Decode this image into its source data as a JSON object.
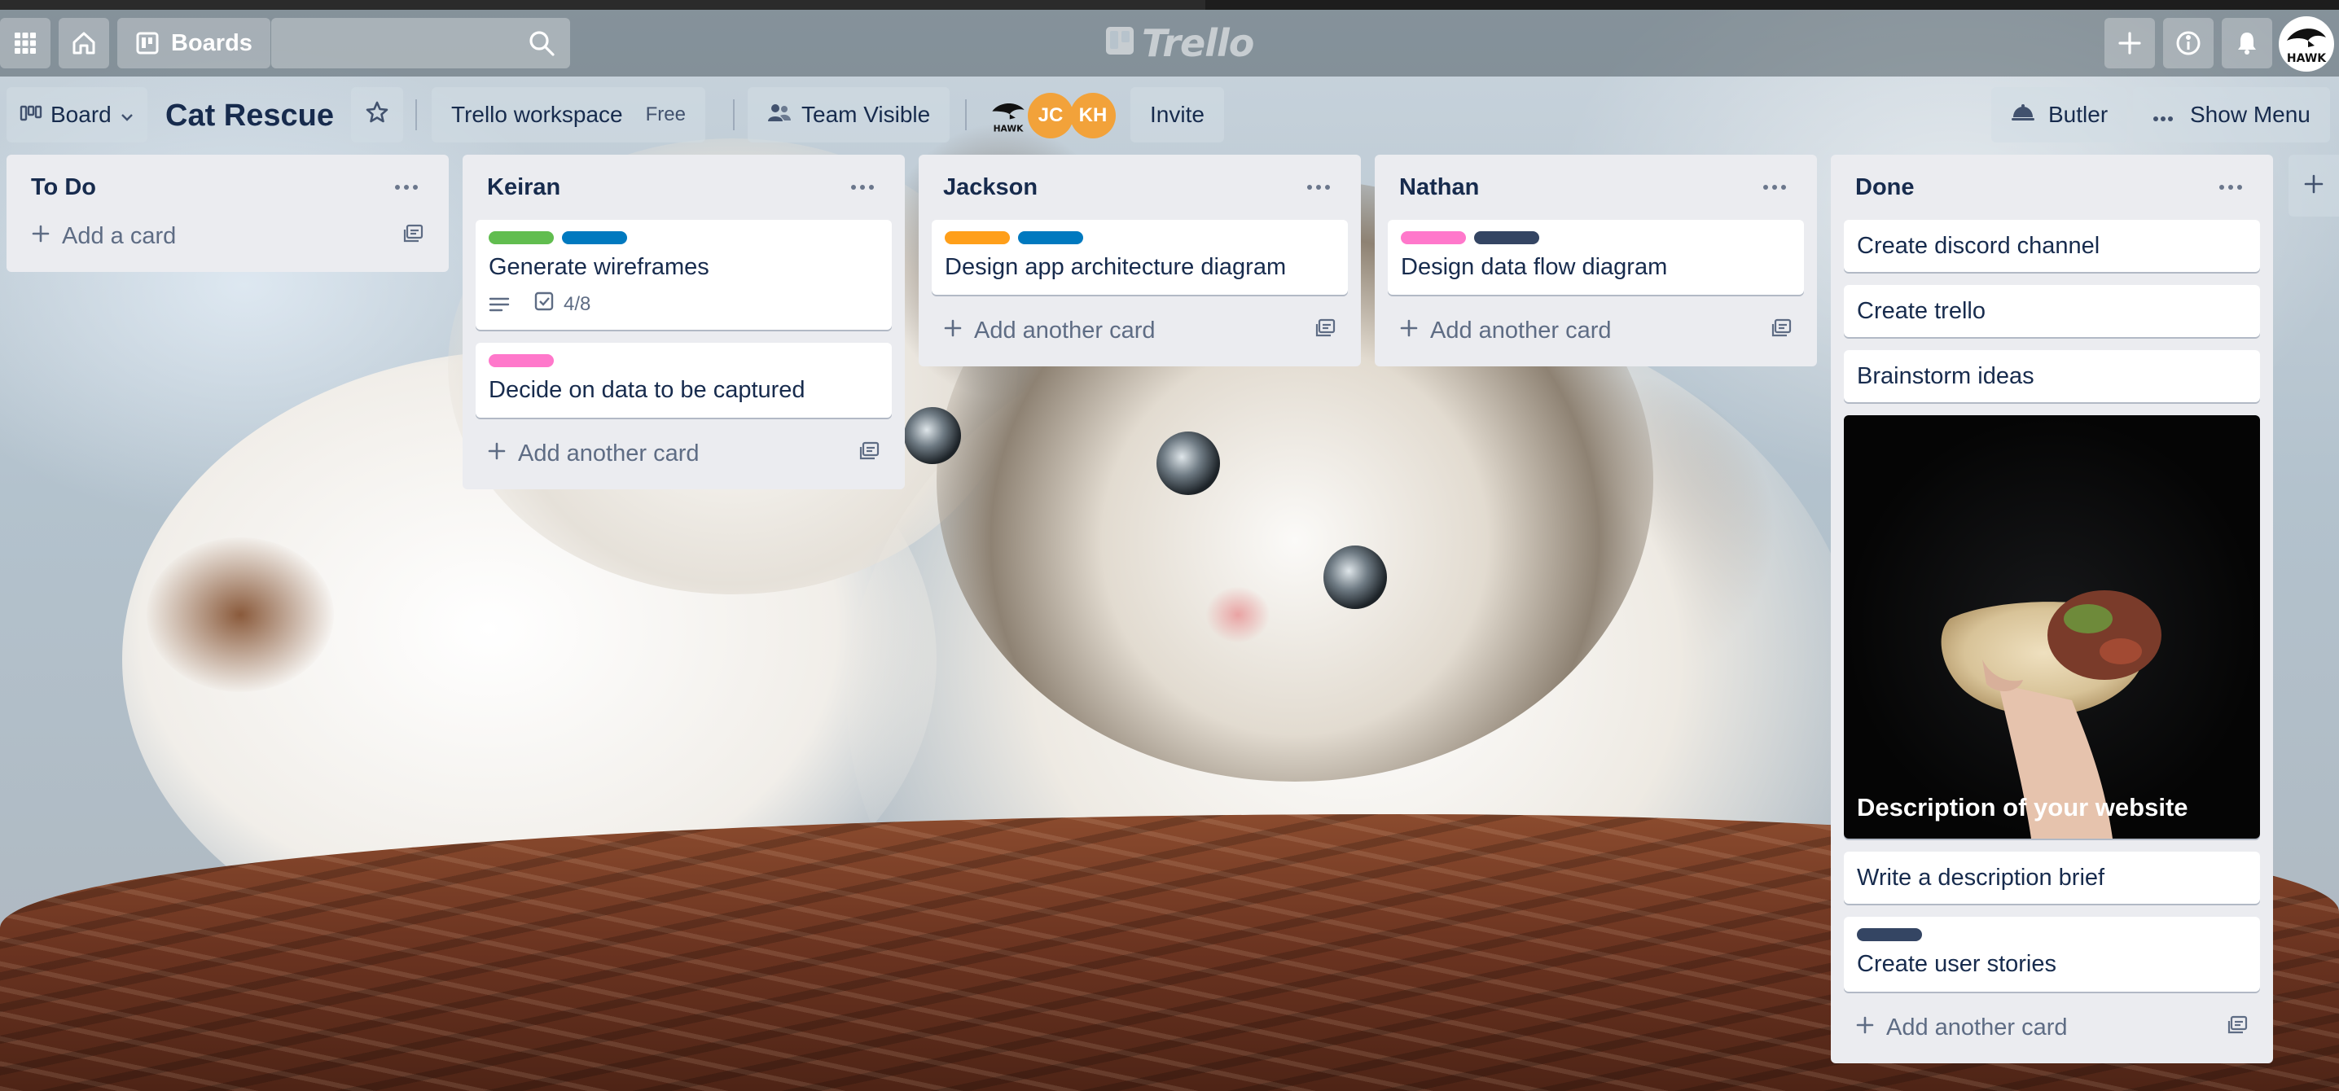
{
  "topbar": {
    "boards_label": "Boards",
    "logo_text": "Trello",
    "icons": [
      "apps-icon",
      "home-icon",
      "boards-icon",
      "search-icon",
      "plus-icon",
      "info-icon",
      "bell-icon"
    ]
  },
  "board": {
    "view_label": "Board",
    "title": "Cat Rescue",
    "workspace": "Trello workspace",
    "workspace_badge": "Free",
    "visibility": "Team Visible",
    "members": [
      {
        "initials": "",
        "kind": "avatar-image"
      },
      {
        "initials": "JC",
        "color": "#f2a23a"
      },
      {
        "initials": "KH",
        "color": "#f2a23a"
      }
    ],
    "invite_label": "Invite",
    "butler_label": "Butler",
    "menu_label": "Show Menu"
  },
  "colors": {
    "green": "#61bd4f",
    "blue": "#0079bf",
    "orange": "#ff9f1a",
    "pink": "#ff78cb",
    "navy": "#344563"
  },
  "lists": [
    {
      "title": "To Do",
      "cards": [],
      "add_label": "Add a card"
    },
    {
      "title": "Keiran",
      "cards": [
        {
          "title": "Generate wireframes",
          "labels": [
            "green",
            "blue"
          ],
          "has_description": true,
          "checklist": "4/8"
        },
        {
          "title": "Decide on data to be captured",
          "labels": [
            "pink"
          ]
        }
      ],
      "add_label": "Add another card"
    },
    {
      "title": "Jackson",
      "cards": [
        {
          "title": "Design app architecture diagram",
          "labels": [
            "orange",
            "blue"
          ]
        }
      ],
      "add_label": "Add another card"
    },
    {
      "title": "Nathan",
      "cards": [
        {
          "title": "Design data flow diagram",
          "labels": [
            "pink",
            "navy"
          ]
        }
      ],
      "add_label": "Add another card"
    },
    {
      "title": "Done",
      "cards": [
        {
          "title": "Create discord channel"
        },
        {
          "title": "Create trello"
        },
        {
          "title": "Brainstorm ideas"
        },
        {
          "title": "Description of your website",
          "cover": "image"
        },
        {
          "title": "Write a description brief"
        },
        {
          "title": "Create user stories",
          "labels": [
            "navy"
          ]
        }
      ],
      "add_label": "Add another card"
    }
  ]
}
